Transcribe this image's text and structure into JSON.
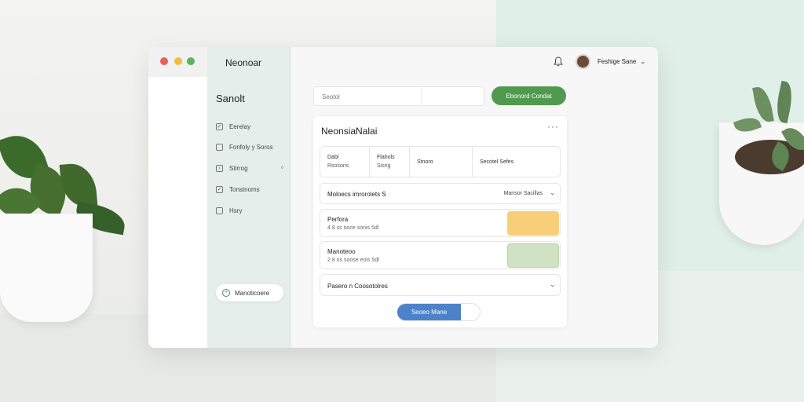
{
  "app": {
    "name": "Neonoar"
  },
  "window_controls": [
    {
      "name": "close",
      "color": "#e8605a"
    },
    {
      "name": "minimize",
      "color": "#f2bd3c"
    },
    {
      "name": "maximize",
      "color": "#5bb55a"
    }
  ],
  "sidebar": {
    "title": "Sanolt",
    "items": [
      {
        "label": "Eerelay",
        "icon": "check-square-icon",
        "badge": ""
      },
      {
        "label": "Fonfoly y Soros",
        "icon": "grid-icon",
        "badge": ""
      },
      {
        "label": "Stirrog",
        "icon": "play-square-icon",
        "badge": "⬨"
      },
      {
        "label": "Tonstnoms",
        "icon": "edit-square-icon",
        "badge": ""
      },
      {
        "label": "Hsry",
        "icon": "square-icon",
        "badge": ""
      }
    ],
    "action_button": {
      "label": "Manoticoere",
      "icon": "plus-circle-icon"
    }
  },
  "topbar": {
    "user_name": "Feshige Sane",
    "bell_icon": "bell-icon",
    "chevron": "⌄"
  },
  "search": {
    "placeholder": "Seotol"
  },
  "primary_button": {
    "label": "Ebonord Condat",
    "color": "#4f9a4e"
  },
  "card": {
    "title": "NeonsiaNalai",
    "more": "···",
    "stats": [
      {
        "line1": "Dabl",
        "line2": "Rsosoris"
      },
      {
        "line1": "Flahols",
        "line2": "Sisrig"
      },
      {
        "line1": "Stnoro",
        "line2": ""
      },
      {
        "line1": "Secotel Sefes",
        "line2": ""
      }
    ],
    "filter_row": {
      "label": "Moloecs imrorolets S",
      "right": "Mansor Sacillas",
      "chevron": "⌄"
    },
    "entries": [
      {
        "title": "Perfora",
        "sub": "4 8 ss ooce sonis 5dl",
        "swatch": "#f7cf78"
      },
      {
        "title": "Manoteoo",
        "sub": "2 8 os soose eois 5dl",
        "swatch": "#cfe3c4"
      }
    ],
    "bottom_row": {
      "label": "Pasero n Coosotolres",
      "chevron": "⌄"
    },
    "toggle": {
      "label": "Seoeo Mane",
      "color": "#4d82c9"
    }
  }
}
